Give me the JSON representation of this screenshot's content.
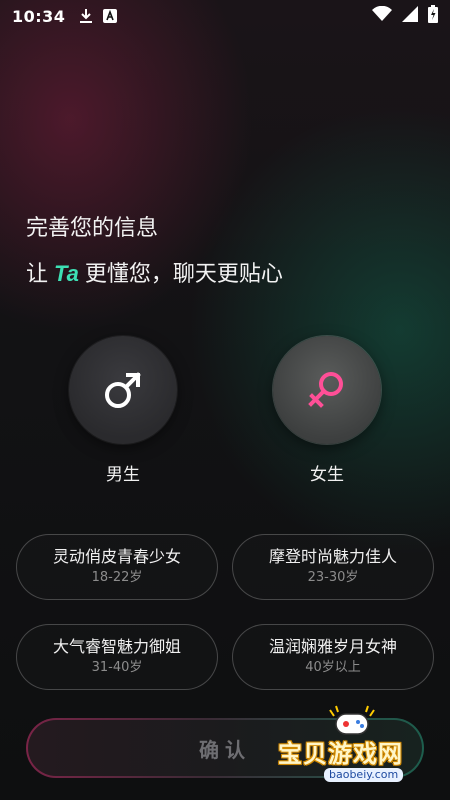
{
  "status_bar": {
    "time": "10:34",
    "icons": [
      "download-icon",
      "font-a-icon",
      "wifi-icon",
      "signal-icon",
      "battery-charging-icon"
    ]
  },
  "heading": {
    "line1": "完善您的信息",
    "line2_prefix": "让",
    "line2_highlight": "Ta",
    "line2_suffix": "更懂您，聊天更贴心",
    "highlight_color": "#3de0b4"
  },
  "gender": {
    "male_label": "男生",
    "female_label": "女生",
    "male_icon": "male-symbol-icon",
    "female_icon": "female-symbol-icon",
    "female_color": "#ff4f97",
    "selected": "female"
  },
  "age_options": [
    {
      "title": "灵动俏皮青春少女",
      "range": "18-22岁"
    },
    {
      "title": "摩登时尚魅力佳人",
      "range": "23-30岁"
    },
    {
      "title": "大气睿智魅力御姐",
      "range": "31-40岁"
    },
    {
      "title": "温润娴雅岁月女神",
      "range": "40岁以上"
    }
  ],
  "confirm_label": "确认",
  "watermark": {
    "text": "宝贝游戏网",
    "url": "baobeiy.com"
  }
}
